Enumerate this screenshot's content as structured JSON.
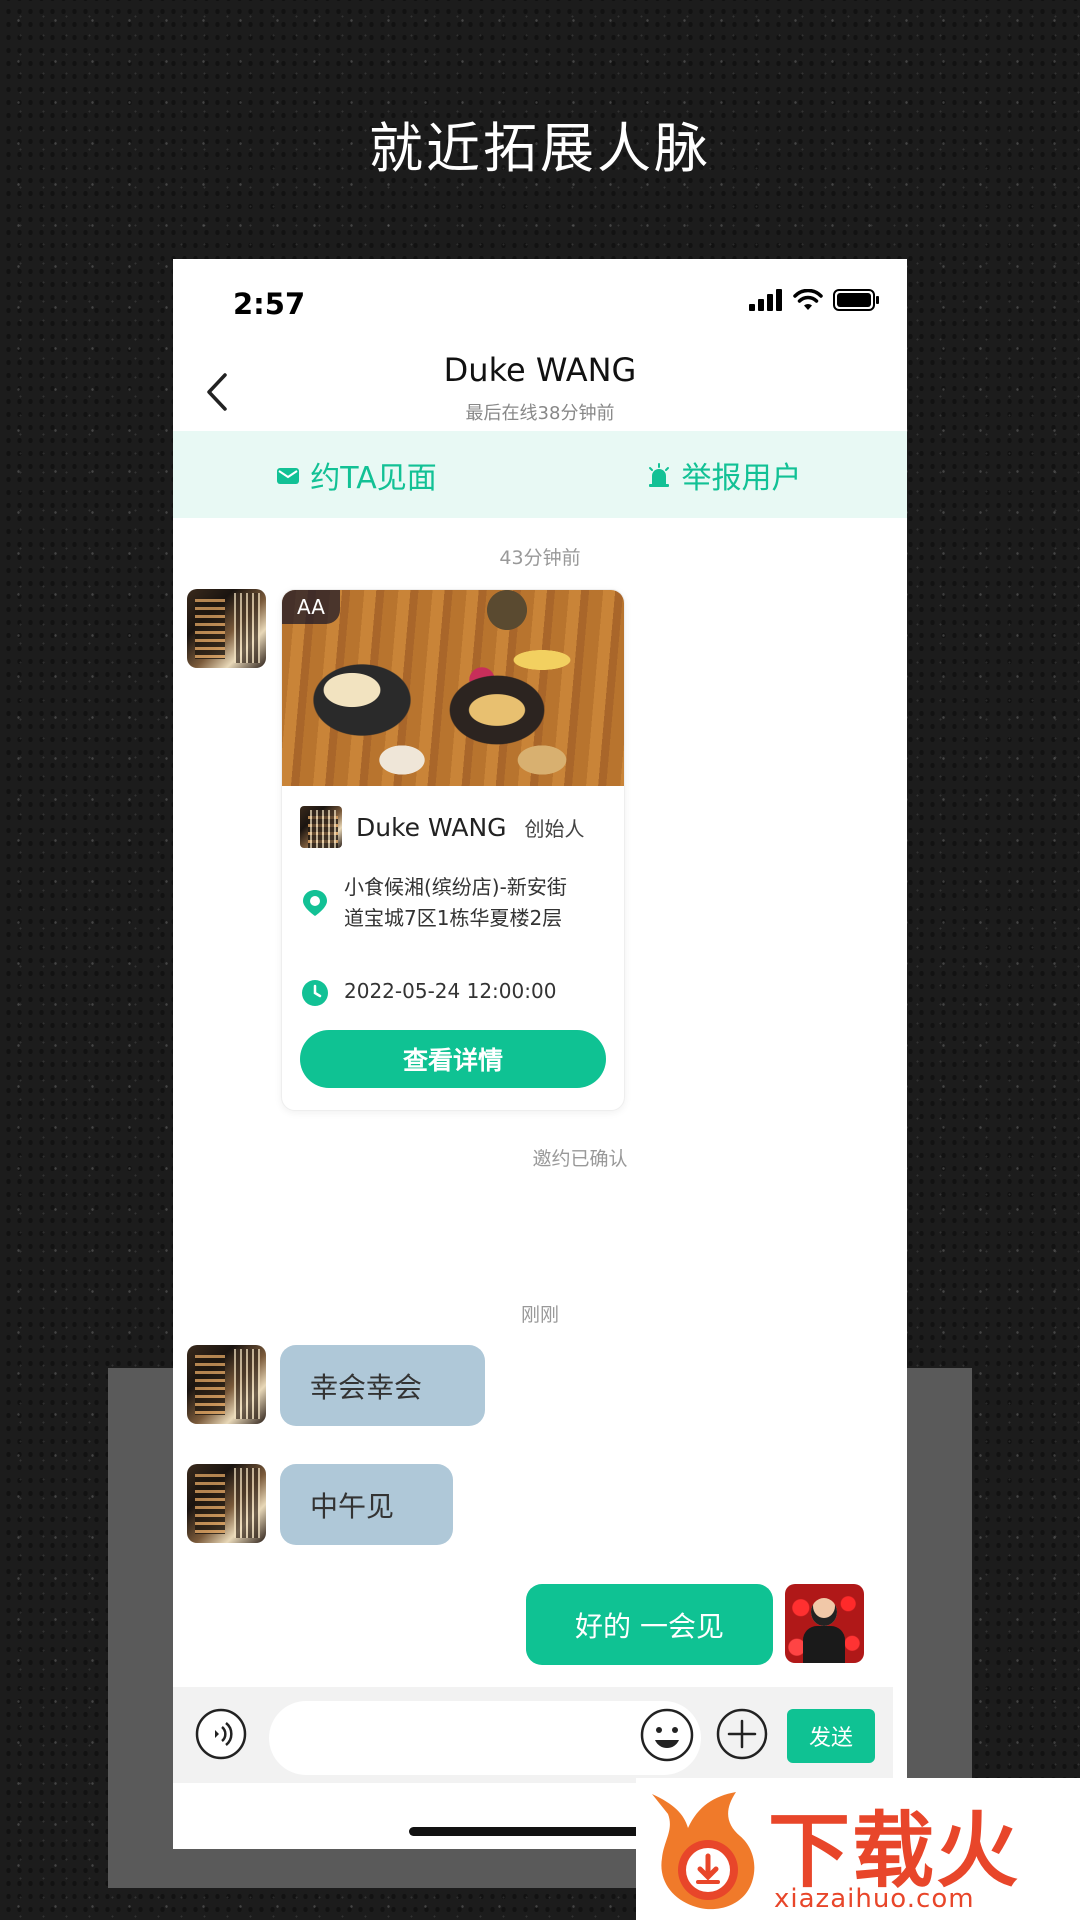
{
  "promo": {
    "headline": "就近拓展人脉"
  },
  "status_bar": {
    "time": "2:57"
  },
  "header": {
    "title": "Duke WANG",
    "subtitle": "最后在线38分钟前"
  },
  "actions": {
    "invite_label": "约TA见面",
    "report_label": "举报用户"
  },
  "chat": {
    "timestamp_1": "43分钟前",
    "invite_card": {
      "badge": "AA",
      "host_name": "Duke WANG",
      "host_role": "创始人",
      "address": "小食候湘(缤纷店)-新安街道宝城7区1栋华夏楼2层",
      "datetime": "2022-05-24 12:00:00",
      "detail_button": "查看详情"
    },
    "invite_status": "邀约已确认",
    "timestamp_2": "刚刚",
    "messages": [
      {
        "from": "other",
        "text": "幸会幸会"
      },
      {
        "from": "other",
        "text": "中午见"
      },
      {
        "from": "self",
        "text": "好的 一会见"
      }
    ]
  },
  "composer": {
    "send_label": "发送"
  },
  "watermark": {
    "brand": "下载火",
    "url": "xiazaihuo.com"
  },
  "colors": {
    "accent": "#0fc293",
    "action_bg": "#e8f9f4",
    "bubble_in": "#afc8d8"
  }
}
